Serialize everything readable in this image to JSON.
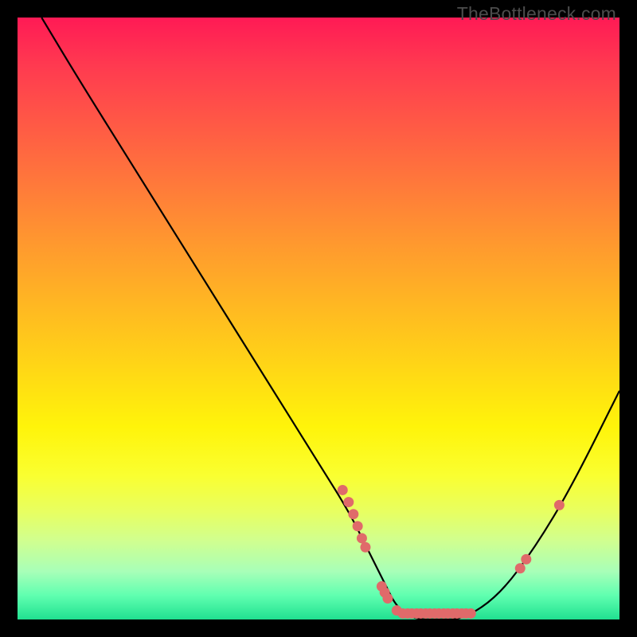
{
  "watermark": "TheBottleneck.com",
  "chart_data": {
    "type": "line",
    "title": "",
    "xlabel": "",
    "ylabel": "",
    "xlim": [
      0,
      100
    ],
    "ylim": [
      0,
      100
    ],
    "series": [
      {
        "name": "curve",
        "x": [
          4,
          10,
          20,
          30,
          40,
          50,
          55,
          58,
          61,
          63,
          66,
          70,
          74,
          80,
          86,
          92,
          100
        ],
        "y": [
          100,
          90,
          74,
          58,
          42,
          26,
          18,
          12,
          6,
          2,
          0,
          0,
          0,
          4,
          12,
          22,
          38
        ]
      }
    ],
    "scatter_points": [
      {
        "x": 54.0,
        "y": 21.5
      },
      {
        "x": 55.0,
        "y": 19.5
      },
      {
        "x": 55.8,
        "y": 17.5
      },
      {
        "x": 56.5,
        "y": 15.5
      },
      {
        "x": 57.2,
        "y": 13.5
      },
      {
        "x": 57.8,
        "y": 12.0
      },
      {
        "x": 60.5,
        "y": 5.5
      },
      {
        "x": 61.0,
        "y": 4.5
      },
      {
        "x": 61.5,
        "y": 3.5
      },
      {
        "x": 63.0,
        "y": 1.5
      },
      {
        "x": 64.0,
        "y": 1.0
      },
      {
        "x": 64.8,
        "y": 1.0
      },
      {
        "x": 65.5,
        "y": 1.0
      },
      {
        "x": 66.3,
        "y": 1.0
      },
      {
        "x": 67.0,
        "y": 1.0
      },
      {
        "x": 67.8,
        "y": 1.0
      },
      {
        "x": 68.5,
        "y": 1.0
      },
      {
        "x": 69.3,
        "y": 1.0
      },
      {
        "x": 70.0,
        "y": 1.0
      },
      {
        "x": 70.8,
        "y": 1.0
      },
      {
        "x": 71.5,
        "y": 1.0
      },
      {
        "x": 72.3,
        "y": 1.0
      },
      {
        "x": 73.0,
        "y": 1.0
      },
      {
        "x": 73.8,
        "y": 1.0
      },
      {
        "x": 74.5,
        "y": 1.0
      },
      {
        "x": 75.3,
        "y": 1.0
      },
      {
        "x": 83.5,
        "y": 8.5
      },
      {
        "x": 84.5,
        "y": 10.0
      },
      {
        "x": 90.0,
        "y": 19.0
      }
    ],
    "colors": {
      "curve": "#000000",
      "points": "#e06a6a"
    }
  }
}
